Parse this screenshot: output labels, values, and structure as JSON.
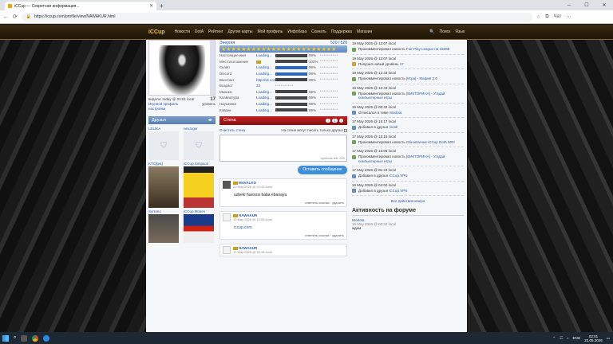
{
  "browser": {
    "tab_title": "iCCup — Секретная информация...",
    "url": "https://iccup.com/profile/view/NAWAKUR.html",
    "chat_label": "Чат"
  },
  "site": {
    "logo": "iCCup",
    "nav": [
      "Новости",
      "DotA",
      "Рейтинг",
      "Другие карты",
      "Мой профиль",
      "Инфобаза",
      "Скачать",
      "Поддержка",
      "Магазин"
    ],
    "search": "Поиск",
    "lang": "Язык"
  },
  "profile": {
    "seen": "видели: today @ 03:01 local",
    "level": "17",
    "level_label": "уровень",
    "game_profile": "Игровой профиль",
    "settings": "настройки"
  },
  "friends": {
    "title": "Друзья",
    "items": [
      {
        "name": "LELIKA"
      },
      {
        "name": "nevarger"
      },
      {
        "name": "KTC[tpa]"
      },
      {
        "name": "iCCup.Simpson"
      },
      {
        "name": "Syrrano"
      },
      {
        "name": "iCCup.Moses"
      }
    ]
  },
  "energy": {
    "label": "Энергия",
    "value": "520 / 520"
  },
  "stats": [
    {
      "k": "Настоящее имя",
      "v": "Loading...",
      "fill": 0.99,
      "pct": "99%"
    },
    {
      "k": "Местоположение",
      "v": "flag",
      "fill": 1.0,
      "pct": "100%"
    },
    {
      "k": "Скайп",
      "v": "Loading...",
      "fill": 0.99,
      "pct": "99%",
      "blue": true
    },
    {
      "k": "Discord",
      "v": "Loading...",
      "fill": 0.99,
      "pct": "99%",
      "blue": true
    },
    {
      "k": "Вконтакт",
      "v": "http://vk.com/",
      "fill": 0.99,
      "pct": "99%"
    },
    {
      "k": "Возраст",
      "v": "33",
      "fill": 0,
      "pct": ""
    },
    {
      "k": "Мышка",
      "v": "Loading...",
      "fill": 0.99,
      "pct": "99%"
    },
    {
      "k": "Клавиатура",
      "v": "Loading...",
      "fill": 0.99,
      "pct": "99%"
    },
    {
      "k": "Наушники",
      "v": "Loading...",
      "fill": 0.99,
      "pct": "99%"
    },
    {
      "k": "Коврик",
      "v": "Loading...",
      "fill": 0.99,
      "pct": "99%"
    }
  ],
  "wall": {
    "title": "Стена",
    "page": "1",
    "clear": "Очистить стену",
    "friends_only": "На стене могут писать только друзья",
    "symbols_left": "symbols left: 200",
    "post_button": "Оставить сообщение",
    "posts": [
      {
        "author": "MAVALKO",
        "date": "20 May 2026 @ 23:43 local",
        "text": "uzbeki huesosi baba ebanaya",
        "actions": "ответить ссылка · удалить"
      },
      {
        "author": "NAWAKUR",
        "date": "19 May 2026 @ 13:09 local",
        "text": "iccup.com",
        "actions": "ответить ссылка · удалить",
        "link": true
      },
      {
        "author": "NAWAKUR",
        "date": "17 May 2026 @ 16:16 local",
        "text": "",
        "actions": ""
      }
    ]
  },
  "events": [
    {
      "date": "19 May 2026 @ 13:07 local",
      "text": "Прокомментировал новость",
      "link": "Fair Play League на 1500$",
      "ic": "g"
    },
    {
      "date": "19 May 2026 @ 13:07 local",
      "text": "Получил новый уровень",
      "link": "17",
      "ic": "y"
    },
    {
      "date": "19 May 2026 @ 12:43 local",
      "text": "Прокомментировал новость",
      "link": "[Игра] - Мафия 2.0",
      "ic": "g"
    },
    {
      "date": "19 May 2026 @ 12:43 local",
      "text": "Прокомментировал новость",
      "link": "[ВИКТОРИНА] - Угадай компьютерные игры",
      "ic": "g"
    },
    {
      "date": "19 May 2026 @ 00:32 local",
      "text": "Отписался в теме",
      "link": "Wodota",
      "ic": "b"
    },
    {
      "date": "17 May 2026 @ 15:17 local",
      "text": "Добавил в друзья",
      "link": "moslr",
      "ic": "b"
    },
    {
      "date": "17 May 2026 @ 15:15 local",
      "text": "Прокомментировал новость",
      "link": "Обновление iCCup DotA 500!",
      "ic": "g"
    },
    {
      "date": "17 May 2026 @ 15:05 local",
      "text": "Прокомментировал новость",
      "link": "[ВИКТОРИНА] - Угадай компьютерные игры",
      "ic": "g"
    },
    {
      "date": "17 May 2026 @ 01:24 local",
      "text": "Добавил в друзья",
      "link": "iCCup.VPN",
      "ic": "b"
    },
    {
      "date": "16 May 2026 @ 04:50 local",
      "text": "Добавил в друзья",
      "link": "iCCup.VPN",
      "ic": "b"
    }
  ],
  "all_events": "Все действия юзера",
  "forum": {
    "title": "Активность на форуме",
    "topic": "Wodota",
    "date": "19 May 2026 @ 00:32 local",
    "snippet": "ждем"
  },
  "taskbar": {
    "lang": "ENG",
    "time": "02:01",
    "date": "22.05.2026"
  }
}
